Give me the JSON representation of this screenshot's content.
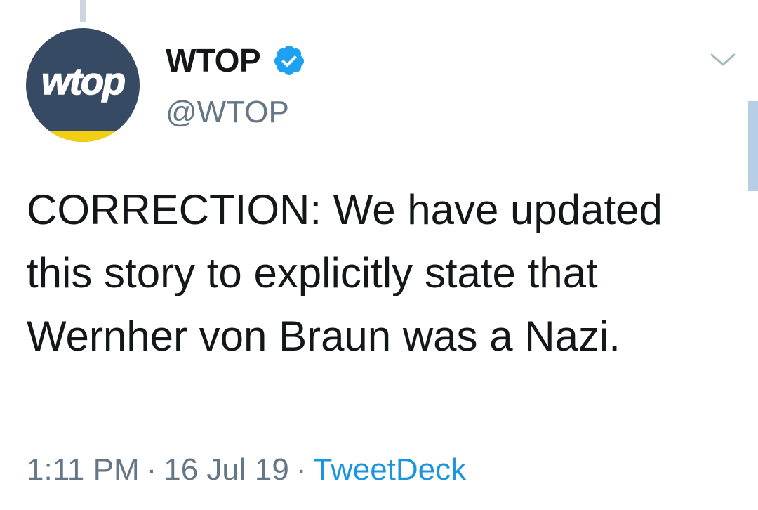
{
  "tweet": {
    "avatar": {
      "logo_text": "wtop",
      "brand_color": "#364b63",
      "band_color": "#f3cf12"
    },
    "author": {
      "display_name": "WTOP",
      "handle": "@WTOP",
      "verified": true,
      "verified_icon": "verified-badge-icon"
    },
    "text": "CORRECTION: We have updated this story to explicitly state that Wernher von Braun was a Nazi.",
    "time": "1:11 PM",
    "separator": "·",
    "date": "16 Jul 19",
    "source": "TweetDeck",
    "menu_icon": "chevron-down-icon"
  },
  "colors": {
    "text": "#14171a",
    "secondary": "#657786",
    "link": "#1b95e0",
    "thread_line": "#ccd6dd",
    "verified": "#1da1f2"
  }
}
